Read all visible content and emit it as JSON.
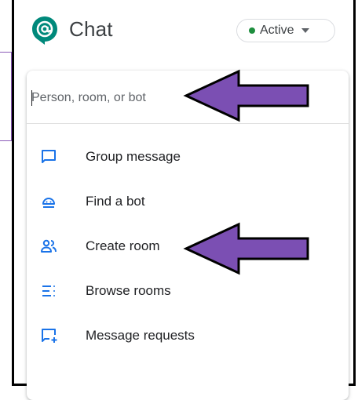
{
  "app": {
    "title": "Chat"
  },
  "status": {
    "label": "Active",
    "color": "#1e8e3e"
  },
  "search": {
    "placeholder": "Person, room, or bot",
    "value": ""
  },
  "menu": {
    "items": [
      {
        "label": "Group message",
        "icon": "chat-bubble-icon"
      },
      {
        "label": "Find a bot",
        "icon": "bot-icon"
      },
      {
        "label": "Create room",
        "icon": "people-icon"
      },
      {
        "label": "Browse rooms",
        "icon": "list-icon"
      },
      {
        "label": "Message requests",
        "icon": "message-request-icon"
      }
    ]
  },
  "colors": {
    "accent": "#1a73e8",
    "logo": "#00897b",
    "arrow_fill": "#7b4fb3"
  }
}
